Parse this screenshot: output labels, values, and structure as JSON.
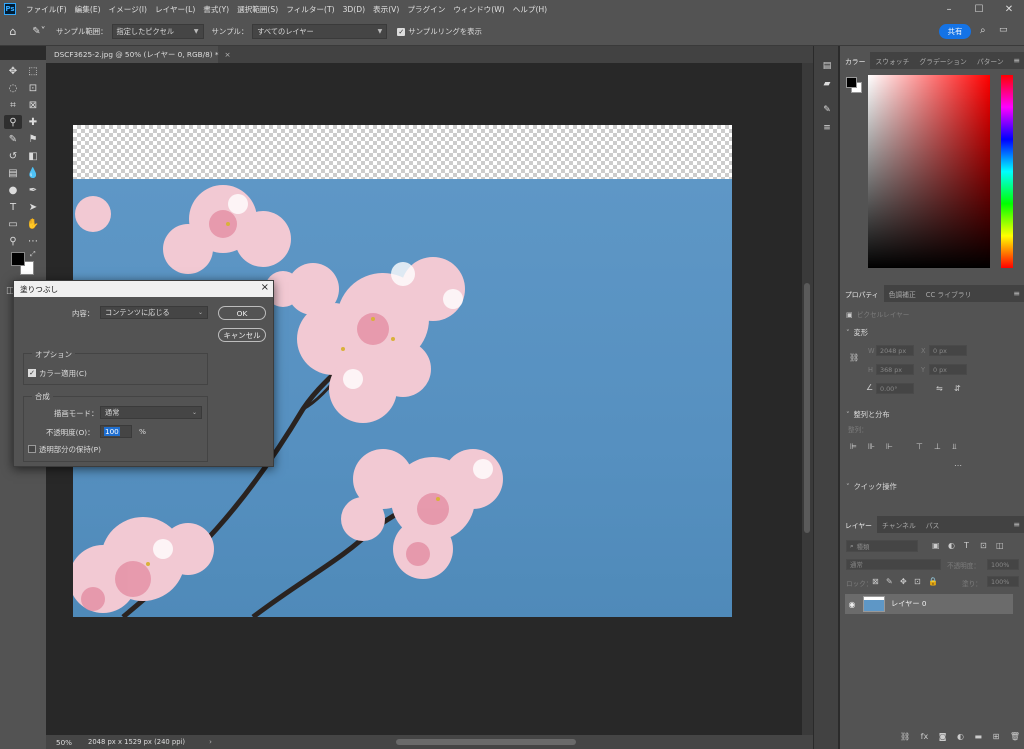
{
  "menubar": {
    "logo": "Ps",
    "items": [
      "ファイル(F)",
      "編集(E)",
      "イメージ(I)",
      "レイヤー(L)",
      "書式(Y)",
      "選択範囲(S)",
      "フィルター(T)",
      "3D(D)",
      "表示(V)",
      "プラグイン",
      "ウィンドウ(W)",
      "ヘルプ(H)"
    ]
  },
  "options": {
    "sample_size_label": "サンプル範囲：",
    "sample_size_value": "指定したピクセル",
    "sample_label": "サンプル：",
    "sample_value": "すべてのレイヤー",
    "show_ring_label": "サンプルリングを表示",
    "share_label": "共有"
  },
  "document": {
    "tab_title": "DSCF3625-2.jpg @ 50% (レイヤー 0, RGB/8) *"
  },
  "status": {
    "zoom": "50%",
    "info": "2048 px x 1529 px (240 ppi)"
  },
  "color_panel": {
    "tabs": [
      "カラー",
      "スウォッチ",
      "グラデーション",
      "パターン"
    ]
  },
  "properties_panel": {
    "tabs": [
      "プロパティ",
      "色調補正",
      "CC ライブラリ"
    ],
    "type": "ピクセルレイヤー",
    "transform_title": "変形",
    "w_label": "W",
    "w_value": "2048 px",
    "x_label": "X",
    "x_value": "0 px",
    "h_label": "H",
    "h_value": "368 px",
    "y_label": "Y",
    "y_value": "0 px",
    "angle_value": "0.00°",
    "align_title": "整列と分布",
    "align_sub": "整列：",
    "quick_title": "クイック操作"
  },
  "layers_panel": {
    "tabs": [
      "レイヤー",
      "チャンネル",
      "パス"
    ],
    "search_placeholder": "種類",
    "blend_mode": "通常",
    "opacity_label": "不透明度：",
    "opacity_value": "100%",
    "lock_label": "ロック：",
    "fill_label": "塗り：",
    "fill_value": "100%",
    "layer_name": "レイヤー 0"
  },
  "dialog": {
    "title": "塗りつぶし",
    "content_label": "内容：",
    "content_value": "コンテンツに応じる",
    "ok_label": "OK",
    "cancel_label": "キャンセル",
    "options_title": "オプション",
    "color_adapt_label": "カラー適用(C)",
    "blending_title": "合成",
    "mode_label": "描画モード：",
    "mode_value": "通常",
    "opacity_label": "不透明度(O)：",
    "opacity_value": "100",
    "percent": "%",
    "preserve_label": "透明部分の保持(P)"
  },
  "colors": {
    "accent": "#1473e6",
    "foreground": "#000000",
    "background": "#ffffff",
    "picker_hue": "#ff0000"
  }
}
